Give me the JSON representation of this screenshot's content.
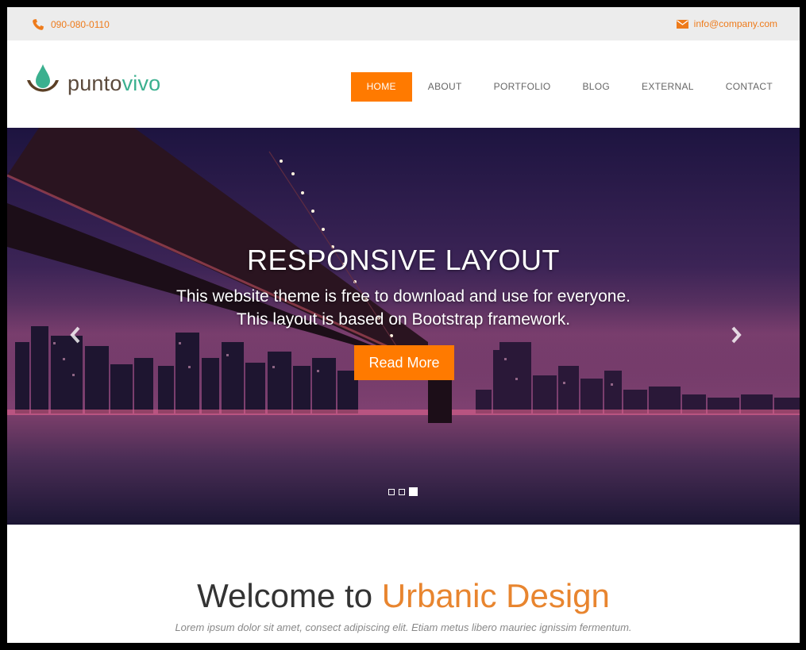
{
  "topbar": {
    "phone": "090-080-0110",
    "email": "info@company.com",
    "phone_icon": "phone-icon",
    "email_icon": "envelope-icon"
  },
  "header": {
    "logo_part1": "punto",
    "logo_part2": "vivo",
    "nav": [
      {
        "label": "HOME",
        "active": true
      },
      {
        "label": "ABOUT",
        "active": false
      },
      {
        "label": "PORTFOLIO",
        "active": false
      },
      {
        "label": "BLOG",
        "active": false
      },
      {
        "label": "EXTERNAL",
        "active": false
      },
      {
        "label": "CONTACT",
        "active": false
      }
    ]
  },
  "hero": {
    "title": "RESPONSIVE LAYOUT",
    "line1": "This website theme is free to download and use for everyone.",
    "line2": "This layout is based on Bootstrap framework.",
    "button": "Read More",
    "prev_icon": "chevron-left-icon",
    "next_icon": "chevron-right-icon",
    "slides": 3,
    "active_slide": 3
  },
  "welcome": {
    "title_plain": "Welcome to ",
    "title_highlight": "Urbanic Design",
    "subtitle": "Lorem ipsum dolor sit amet, consect adipiscing elit. Etiam metus libero mauriec ignissim fermentum."
  },
  "colors": {
    "accent": "#ff7a00",
    "brand_green": "#3bb08f",
    "brand_brown": "#5b4a3c"
  }
}
